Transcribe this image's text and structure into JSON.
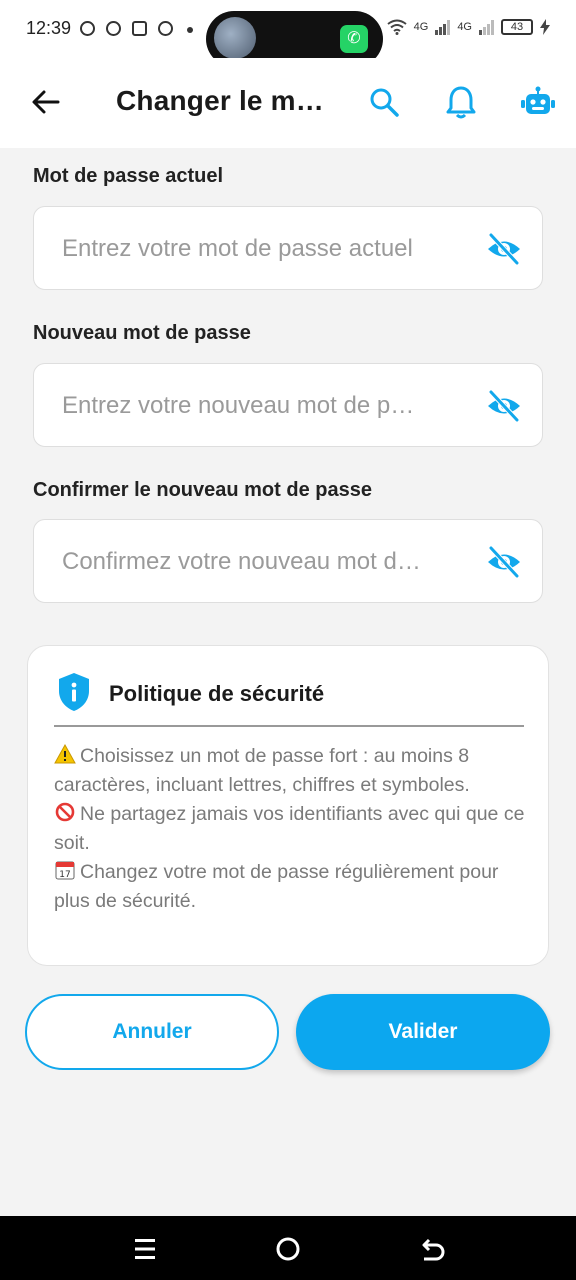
{
  "status_bar": {
    "time": "12:39",
    "network_1": "4G",
    "network_2": "4G",
    "battery": "43"
  },
  "app_bar": {
    "title": "Changer le m…"
  },
  "form": {
    "current": {
      "label": "Mot de passe actuel",
      "placeholder": "Entrez votre mot de passe actuel"
    },
    "new": {
      "label": "Nouveau mot de passe",
      "placeholder": "Entrez votre nouveau mot de p…"
    },
    "confirm": {
      "label": "Confirmer le nouveau mot de passe",
      "placeholder": "Confirmez votre nouveau mot d…"
    }
  },
  "security_card": {
    "title": "Politique de sécurité",
    "items": [
      {
        "icon": "warning-icon",
        "text": "Choisissez un mot de passe fort : au moins 8 caractères, incluant lettres, chiffres et symboles."
      },
      {
        "icon": "prohibited-icon",
        "text": "Ne partagez jamais vos identifiants avec qui que ce soit."
      },
      {
        "icon": "calendar-icon",
        "text": "Changez votre mot de passe régulièrement pour plus de sécurité."
      }
    ]
  },
  "actions": {
    "cancel_label": "Annuler",
    "submit_label": "Valider"
  },
  "colors": {
    "accent": "#0ca7ef",
    "background": "#f3f3f3"
  }
}
